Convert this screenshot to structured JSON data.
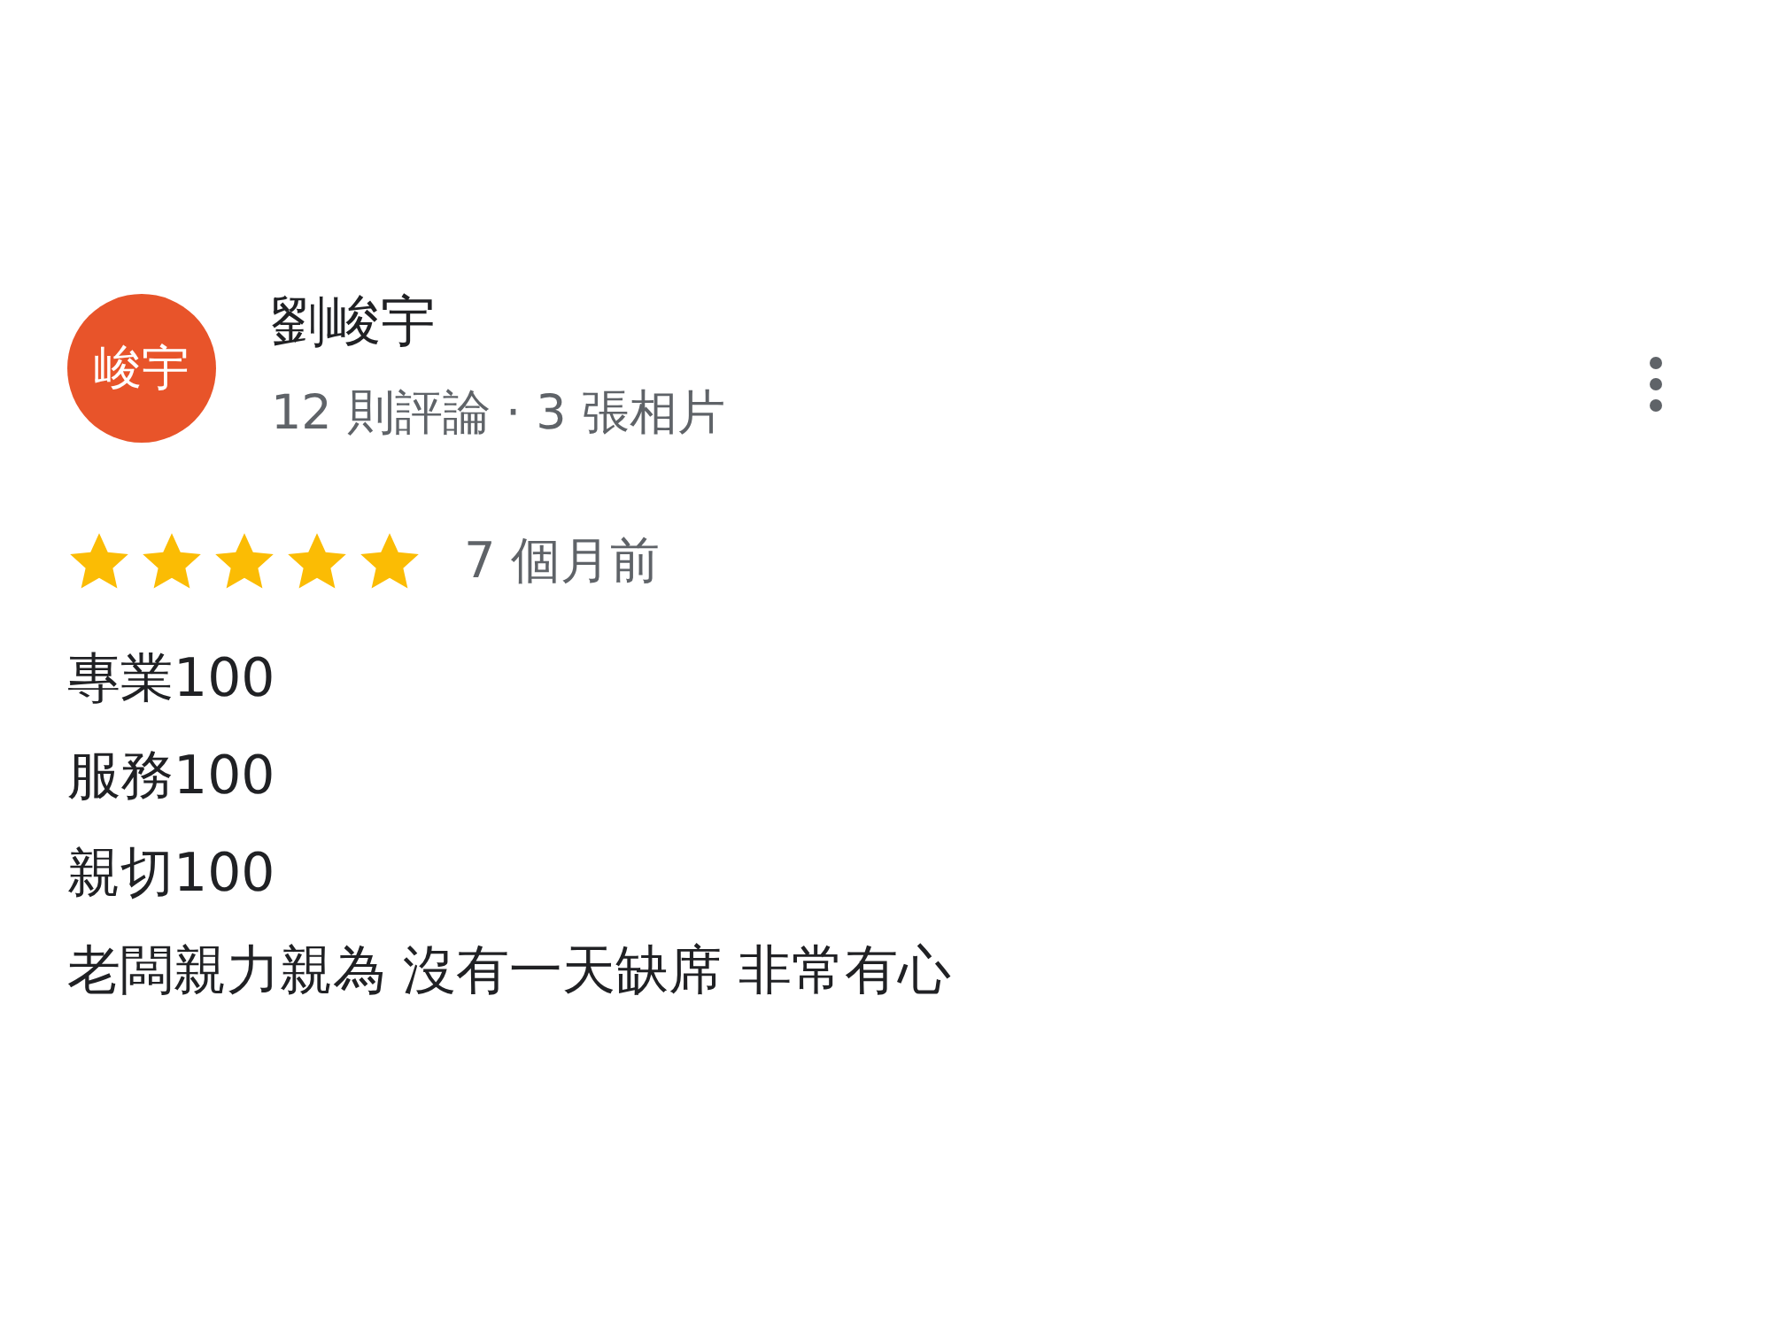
{
  "review": {
    "avatar_text": "峻宇",
    "author": "劉峻宇",
    "meta": "12 則評論 · 3 張相片",
    "stars": 5,
    "time": "7 個月前",
    "lines": [
      "專業100",
      "服務100",
      "親切100",
      "老闆親力親為 沒有一天缺席 非常有心"
    ]
  }
}
